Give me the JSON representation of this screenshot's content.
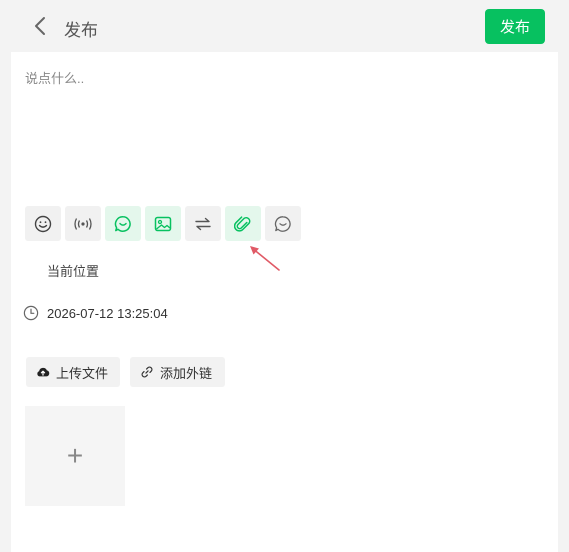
{
  "header": {
    "title": "发布",
    "publish_label": "发布"
  },
  "editor": {
    "placeholder": "说点什么.."
  },
  "toolbar": {
    "icons": [
      "emoji-icon",
      "wifi-signal-icon",
      "chat-bubble-icon",
      "image-icon",
      "swap-icon",
      "paperclip-icon",
      "comment-icon"
    ],
    "selected": "paperclip-icon"
  },
  "location": {
    "label": "当前位置"
  },
  "time": {
    "value": "2026-07-12 13:25:04"
  },
  "actions": {
    "upload_file_label": "上传文件",
    "add_link_label": "添加外链"
  },
  "upload": {
    "plus_symbol": "+"
  },
  "colors": {
    "accent": "#07c160",
    "annotation_arrow": "#e05a66"
  }
}
